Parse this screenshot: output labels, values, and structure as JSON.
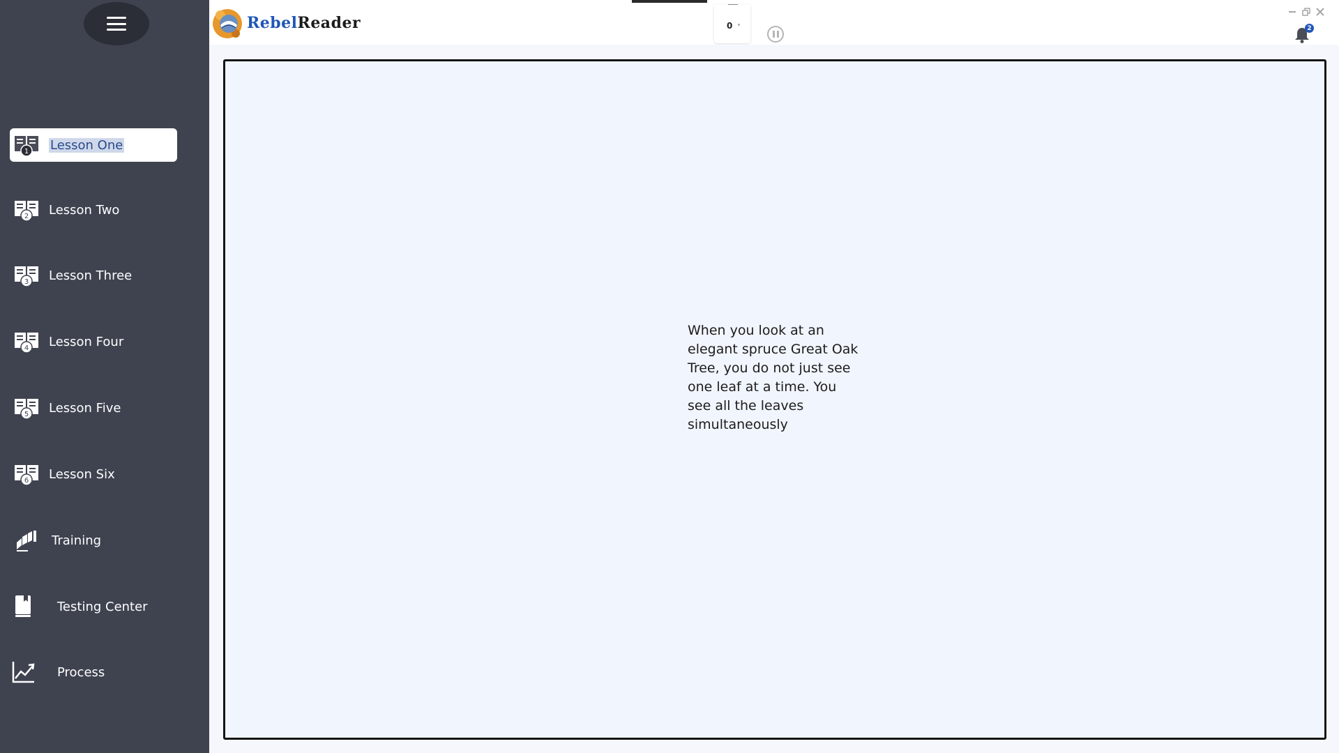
{
  "app": {
    "brand_part1": "Rebel",
    "brand_part2": "Reader"
  },
  "sidebar": {
    "items": [
      {
        "label": "Lesson One",
        "icon": "lesson-1-icon",
        "badge": "1",
        "active": true
      },
      {
        "label": "Lesson Two",
        "icon": "lesson-2-icon",
        "badge": "2"
      },
      {
        "label": "Lesson Three",
        "icon": "lesson-3-icon",
        "badge": "3"
      },
      {
        "label": "Lesson Four",
        "icon": "lesson-4-icon",
        "badge": "4"
      },
      {
        "label": "Lesson Five",
        "icon": "lesson-5-icon",
        "badge": "5"
      },
      {
        "label": "Lesson Six",
        "icon": "lesson-6-icon",
        "badge": "6"
      },
      {
        "label": "Training",
        "icon": "training-icon"
      },
      {
        "label": "Testing Center",
        "icon": "book-icon"
      },
      {
        "label": "Process",
        "icon": "chart-line-icon"
      }
    ]
  },
  "toolbar": {
    "counter_value": "0"
  },
  "notifications": {
    "count": "2"
  },
  "passage": {
    "text": "When you look at an elegant spruce Great Oak Tree, you do not just see one leaf at a time. You see all the leaves simultaneously"
  },
  "colors": {
    "sidebar_bg": "#3f4350",
    "accent": "#1f56b8",
    "reading_bg": "#f1f5fd"
  }
}
